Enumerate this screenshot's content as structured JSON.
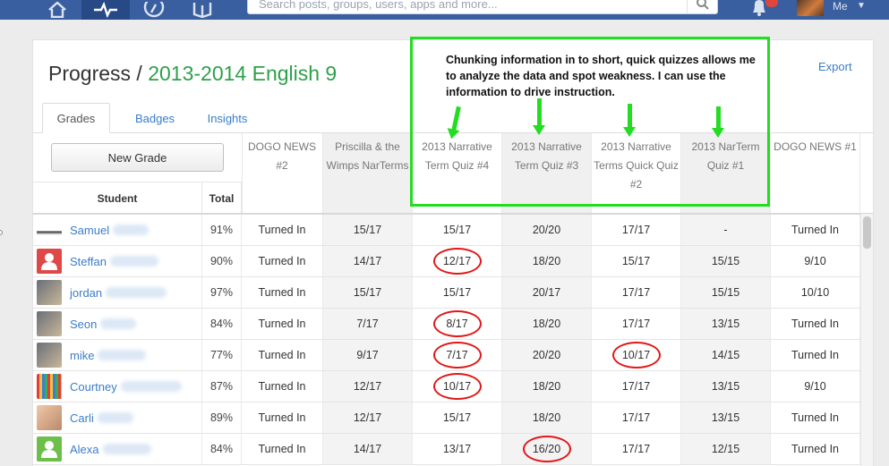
{
  "search": {
    "placeholder": "Search posts, groups, users, apps and more..."
  },
  "user_menu": {
    "label": "Me"
  },
  "page": {
    "title_prefix": "Progress / ",
    "course": "2013-2014 English 9",
    "export_label": "Export"
  },
  "tabs": [
    {
      "label": "Grades",
      "active": true
    },
    {
      "label": "Badges",
      "active": false
    },
    {
      "label": "Insights",
      "active": false
    }
  ],
  "toolbar": {
    "new_grade_label": "New Grade"
  },
  "columns": {
    "student": "Student",
    "total": "Total",
    "assignments": [
      "DOGO NEWS #2",
      "Priscilla & the Wimps NarTerms",
      "2013 Narrative Term Quiz #4",
      "2013 Narrative Term Quiz #3",
      "2013 Narrative Terms Quick Quiz #2",
      "2013 NarTerm Quiz #1",
      "DOGO NEWS #1"
    ]
  },
  "rows": [
    {
      "name": "Samuel",
      "total": "91%",
      "grades": [
        "Turned In",
        "15/17",
        "15/17",
        "20/20",
        "17/17",
        "-",
        "Turned In"
      ],
      "avatar": "chill-image"
    },
    {
      "name": "Steffan",
      "total": "90%",
      "grades": [
        "Turned In",
        "14/17",
        "12/17",
        "18/20",
        "15/17",
        "15/15",
        "9/10"
      ],
      "avatar": "default-red-user-icon"
    },
    {
      "name": "jordan",
      "total": "97%",
      "grades": [
        "Turned In",
        "15/17",
        "15/17",
        "20/17",
        "17/17",
        "15/15",
        "10/10"
      ],
      "avatar": "photo"
    },
    {
      "name": "Seon",
      "total": "84%",
      "grades": [
        "Turned In",
        "7/17",
        "8/17",
        "18/20",
        "17/17",
        "13/15",
        "Turned In"
      ],
      "avatar": "photo"
    },
    {
      "name": "mike",
      "total": "77%",
      "grades": [
        "Turned In",
        "9/17",
        "7/17",
        "20/20",
        "10/17",
        "14/15",
        "Turned In"
      ],
      "avatar": "photo"
    },
    {
      "name": "Courtney",
      "total": "87%",
      "grades": [
        "Turned In",
        "12/17",
        "10/17",
        "18/20",
        "17/17",
        "13/15",
        "9/10"
      ],
      "avatar": "colored-pencils"
    },
    {
      "name": "Carli",
      "total": "89%",
      "grades": [
        "Turned In",
        "12/17",
        "15/17",
        "18/20",
        "17/17",
        "13/15",
        "Turned In"
      ],
      "avatar": "baby-photo"
    },
    {
      "name": "Alexa",
      "total": "84%",
      "grades": [
        "Turned In",
        "14/17",
        "13/17",
        "16/20",
        "17/17",
        "12/15",
        "Turned In"
      ],
      "avatar": "default-green-user-icon"
    }
  ],
  "annotation": {
    "text": "Chunking information in to short, quick quizzes allows me to analyze the data and spot weakness. I can use the information to drive instruction.",
    "highlight_color": "#22dd22",
    "circle_color": "#e01818"
  }
}
